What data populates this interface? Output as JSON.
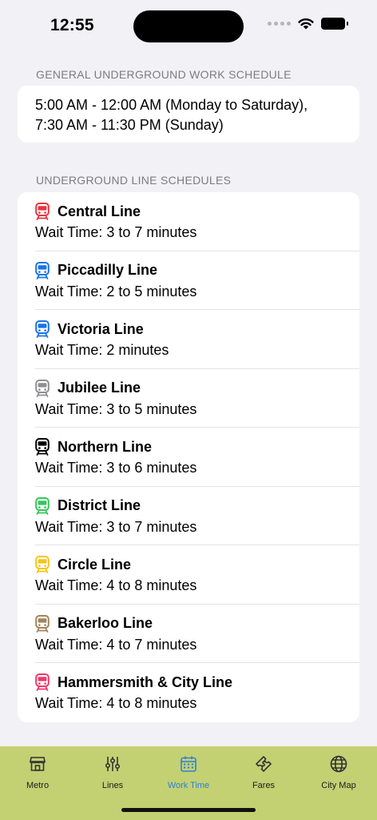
{
  "status_bar": {
    "time": "12:55"
  },
  "general": {
    "header": "GENERAL UNDERGROUND WORK SCHEDULE",
    "line1": "5:00 AM - 12:00 AM (Monday to Saturday),",
    "line2": "7:30 AM - 11:30 PM (Sunday)"
  },
  "lines": {
    "header": "UNDERGROUND LINE SCHEDULES",
    "items": [
      {
        "name": "Central Line",
        "wait": "Wait Time: 3 to 7 minutes",
        "color": "#e8343f",
        "icon": "train-icon"
      },
      {
        "name": "Piccadilly Line",
        "wait": "Wait Time: 2 to 5 minutes",
        "color": "#1a73e8",
        "icon": "train-icon"
      },
      {
        "name": "Victoria Line",
        "wait": "Wait Time: 2 minutes",
        "color": "#1a73e8",
        "icon": "train-icon"
      },
      {
        "name": "Jubilee Line",
        "wait": "Wait Time: 3 to 5 minutes",
        "color": "#8e8e93",
        "icon": "train-icon"
      },
      {
        "name": "Northern Line",
        "wait": "Wait Time: 3 to 6 minutes",
        "color": "#000000",
        "icon": "train-icon"
      },
      {
        "name": "District Line",
        "wait": "Wait Time: 3 to 7 minutes",
        "color": "#34c759",
        "icon": "train-icon"
      },
      {
        "name": "Circle Line",
        "wait": "Wait Time: 4 to 8 minutes",
        "color": "#f5c518",
        "icon": "train-icon"
      },
      {
        "name": "Bakerloo Line",
        "wait": "Wait Time: 4 to 7 minutes",
        "color": "#a2845e",
        "icon": "train-icon"
      },
      {
        "name": "Hammersmith & City Line",
        "wait": "Wait Time: 4 to 8 minutes",
        "color": "#f0386b",
        "icon": "train-icon"
      }
    ]
  },
  "tab_bar": {
    "accent": "#2f7fd6",
    "background": "#c3d173",
    "tabs": [
      {
        "label": "Metro",
        "icon": "storefront-icon"
      },
      {
        "label": "Lines",
        "icon": "sliders-icon"
      },
      {
        "label": "Work Time",
        "icon": "calendar-icon",
        "active": true
      },
      {
        "label": "Fares",
        "icon": "ticket-icon"
      },
      {
        "label": "City Map",
        "icon": "globe-icon"
      }
    ]
  }
}
